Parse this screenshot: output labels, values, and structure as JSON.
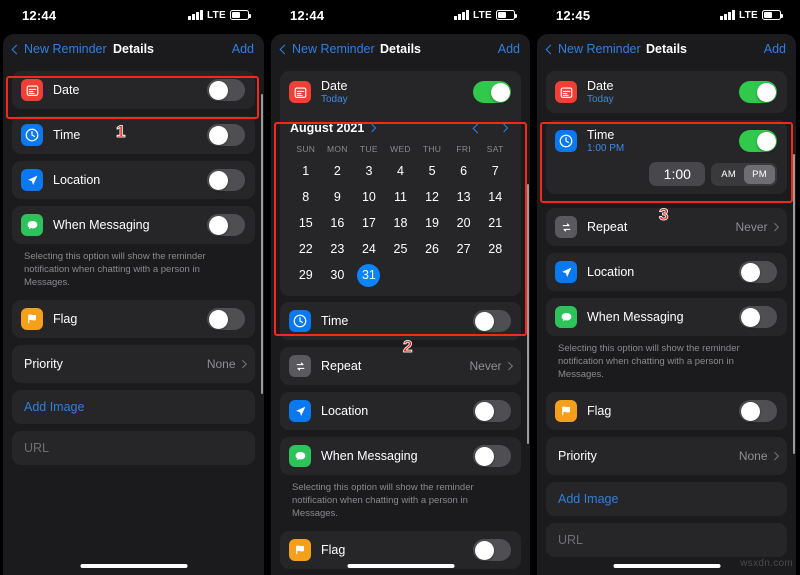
{
  "watermark": "wsxdn.com",
  "nav": {
    "back_label": "New Reminder",
    "title": "Details",
    "add_label": "Add"
  },
  "labels": {
    "date": "Date",
    "time": "Time",
    "location": "Location",
    "when_messaging": "When Messaging",
    "repeat": "Repeat",
    "flag": "Flag",
    "priority": "Priority",
    "add_image": "Add Image",
    "url_placeholder": "URL",
    "never": "Never",
    "none": "None",
    "today": "Today",
    "time_value": "1:00 PM",
    "footnote": "Selecting this option will show the reminder notification when chatting with a person in Messages."
  },
  "calendar": {
    "month_label": "August 2021",
    "dow": [
      "SUN",
      "MON",
      "TUE",
      "WED",
      "THU",
      "FRI",
      "SAT"
    ],
    "days": [
      1,
      2,
      3,
      4,
      5,
      6,
      7,
      8,
      9,
      10,
      11,
      12,
      13,
      14,
      15,
      16,
      17,
      18,
      19,
      20,
      21,
      22,
      23,
      24,
      25,
      26,
      27,
      28,
      29,
      30,
      31
    ],
    "selected_day": 31,
    "lead_blanks": 0
  },
  "time_picker": {
    "value": "1:00",
    "am_label": "AM",
    "pm_label": "PM",
    "selected_meridiem": "PM"
  },
  "panels": [
    {
      "id": "panel-1",
      "status_time": "12:44",
      "carrier": "LTE",
      "step": "1",
      "toggles": {
        "date": "off",
        "time": "off",
        "location": "off",
        "messaging": "off",
        "flag": "off"
      }
    },
    {
      "id": "panel-2",
      "status_time": "12:44",
      "carrier": "LTE",
      "step": "2",
      "toggles": {
        "date": "on",
        "time": "off",
        "location": "off",
        "messaging": "off"
      }
    },
    {
      "id": "panel-3",
      "status_time": "12:45",
      "carrier": "LTE",
      "step": "3",
      "toggles": {
        "date": "on",
        "time": "on",
        "location": "off",
        "messaging": "off",
        "flag": "off"
      }
    }
  ],
  "colors": {
    "accent_blue": "#2f7fe0",
    "toggle_on": "#30c94b",
    "selected_day": "#0a84ff",
    "highlight_red": "#f3291b",
    "icon_date": "#ef4036",
    "icon_time": "#0a78ef",
    "icon_location": "#0a78ef",
    "icon_messaging": "#2ec25a",
    "icon_flag": "#f5a01b",
    "icon_repeat": "#5a5a5e"
  }
}
